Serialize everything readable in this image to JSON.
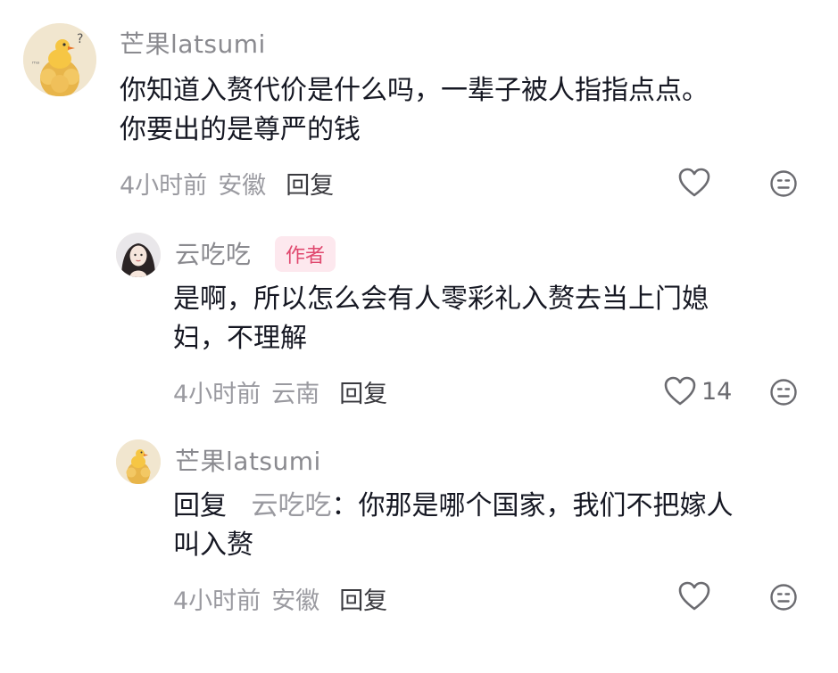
{
  "comments": [
    {
      "username": "芒果latsumi",
      "content_lines": [
        "你知道入赘代价是什么吗，一辈子被人指指点点。",
        "你要出的是尊严的钱"
      ],
      "time": "4小时前",
      "location": "安徽",
      "reply_label": "回复",
      "like_icon": "heart-icon",
      "dislike_icon": "dislike-face-icon"
    },
    {
      "username": "云吃吃",
      "badge": "作者",
      "content_lines": [
        "是啊，所以怎么会有人零彩礼入赘去当上门媳",
        "妇，不理解"
      ],
      "time": "4小时前",
      "location": "云南",
      "reply_label": "回复",
      "like_count": "14",
      "like_icon": "heart-icon",
      "dislike_icon": "dislike-face-icon"
    },
    {
      "username": "芒果latsumi",
      "reply_prefix": "回复",
      "reply_target": "云吃吃",
      "reply_colon": "：",
      "content_line1_rest": "你那是哪个国家，我们不把嫁人",
      "content_line2": "叫入赘",
      "time": "4小时前",
      "location": "安徽",
      "reply_label": "回复",
      "like_icon": "heart-icon",
      "dislike_icon": "dislike-face-icon"
    }
  ],
  "colors": {
    "username": "#8a8a8f",
    "badge_text": "#e0486e",
    "badge_bg": "#fde8ee",
    "meta": "#9a9aa0",
    "text": "#161823"
  }
}
